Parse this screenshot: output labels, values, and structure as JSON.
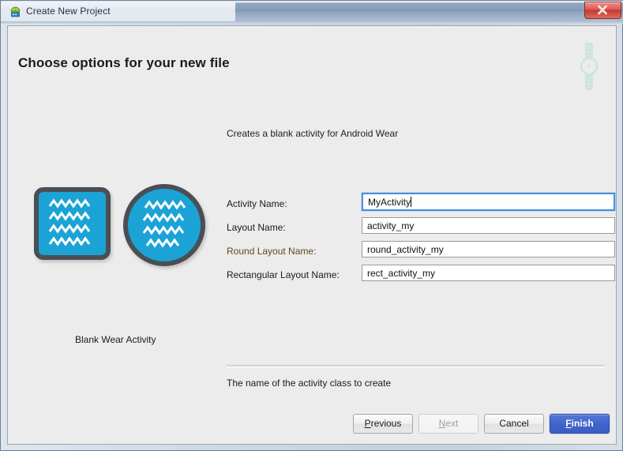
{
  "window": {
    "title": "Create New Project",
    "icon": "android-project-icon",
    "close_label": "x"
  },
  "dialog": {
    "heading": "Choose options for your new file",
    "description": "Creates a blank activity for Android Wear",
    "decoration_icon": "android-wear-watch-icon"
  },
  "preview": {
    "square_thumbnail": "rectangular-wear-preview",
    "circle_thumbnail": "round-wear-preview",
    "caption": "Blank Wear Activity"
  },
  "form": {
    "fields": [
      {
        "label": "Activity Name:",
        "value": "MyActivity",
        "placeholder": "",
        "focused": true,
        "highlighted_label": false,
        "name": "activity-name"
      },
      {
        "label": "Layout Name:",
        "value": "activity_my",
        "placeholder": "",
        "focused": false,
        "highlighted_label": false,
        "name": "layout-name"
      },
      {
        "label": "Round Layout Name:",
        "value": "round_activity_my",
        "placeholder": "",
        "focused": false,
        "highlighted_label": true,
        "name": "round-layout-name"
      },
      {
        "label": "Rectangular Layout Name:",
        "value": "rect_activity_my",
        "placeholder": "",
        "focused": false,
        "highlighted_label": false,
        "name": "rectangular-layout-name"
      }
    ]
  },
  "help": {
    "text": "The name of the activity class to create"
  },
  "buttons": {
    "previous": {
      "label": "Previous",
      "mnemonic": "P",
      "rest": "revious",
      "disabled": false
    },
    "next": {
      "label": "Next",
      "mnemonic": "N",
      "rest": "ext",
      "disabled": true
    },
    "cancel": {
      "label": "Cancel",
      "mnemonic": "",
      "rest": "Cancel",
      "disabled": false
    },
    "finish": {
      "label": "Finish",
      "mnemonic": "F",
      "rest": "inish",
      "disabled": false
    }
  },
  "colors": {
    "accent_blue": "#3f63cd",
    "focus_border": "#4b8fd6",
    "thumb_fill": "#1ba3d6",
    "thumb_border": "#4a4f55",
    "title_gradient_top": "#93a8c2",
    "close_red": "#c33a31",
    "panel_bg": "#ececec",
    "olive_label": "#5c4a18"
  }
}
